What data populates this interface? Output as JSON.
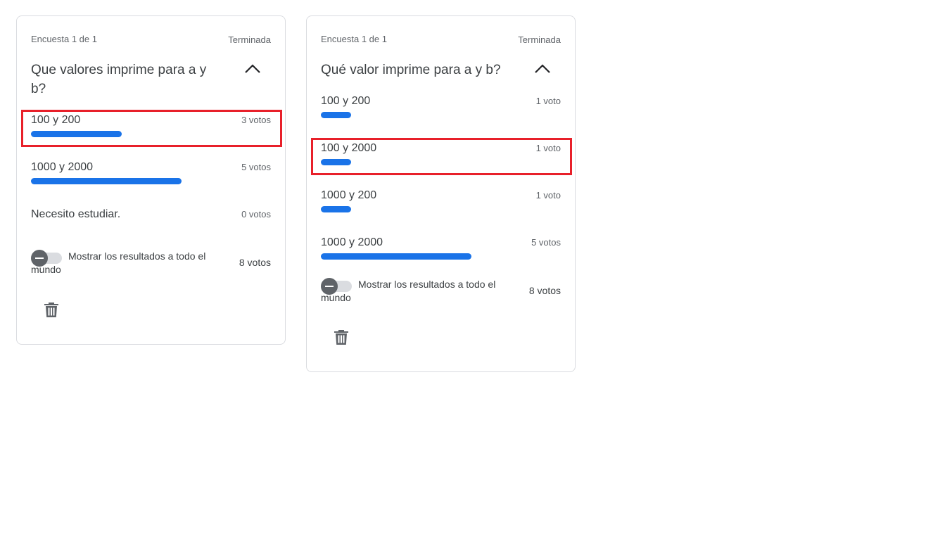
{
  "polls": [
    {
      "counter": "Encuesta 1 de 1",
      "status": "Terminada",
      "question": "Que valores imprime para a y b?",
      "options": [
        {
          "label": "100 y 200",
          "votes_text": "3 votos",
          "fraction": 0.375,
          "highlighted": true
        },
        {
          "label": "1000 y 2000",
          "votes_text": "5 votos",
          "fraction": 0.625,
          "highlighted": false
        },
        {
          "label": "Necesito estudiar.",
          "votes_text": "0 votos",
          "fraction": 0,
          "highlighted": false
        }
      ],
      "show_results_label": "Mostrar los resultados a todo el mundo",
      "show_results_on": false,
      "total": "8 votos"
    },
    {
      "counter": "Encuesta 1 de 1",
      "status": "Terminada",
      "question": "Qué valor imprime para a y b?",
      "options": [
        {
          "label": "100 y 200",
          "votes_text": "1 voto",
          "fraction": 0.125,
          "highlighted": false
        },
        {
          "label": "100 y 2000",
          "votes_text": "1 voto",
          "fraction": 0.125,
          "highlighted": true
        },
        {
          "label": "1000 y 200",
          "votes_text": "1 voto",
          "fraction": 0.125,
          "highlighted": false
        },
        {
          "label": "1000 y 2000",
          "votes_text": "5 votos",
          "fraction": 0.625,
          "highlighted": false
        }
      ],
      "show_results_label": "Mostrar los resultados a todo el mundo",
      "show_results_on": false,
      "total": "8 votos"
    }
  ],
  "icons": {
    "collapse": "chevron-up-icon",
    "delete": "trash-icon"
  },
  "colors": {
    "bar": "#1a73e8",
    "highlight": "#e8202a"
  }
}
